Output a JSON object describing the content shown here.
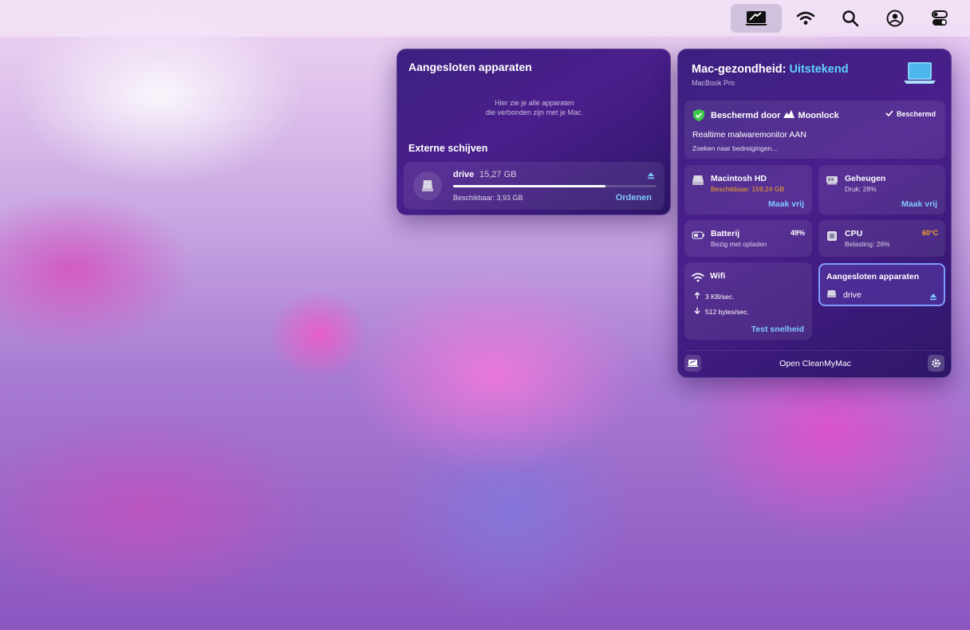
{
  "colors": {
    "accent_blue": "#7fc7ff",
    "status_good": "#5fd4ff",
    "warning_orange": "#f5a623",
    "shield_green": "#3bc94a"
  },
  "menubar": {
    "icons": [
      "cleanmymac-menu-icon",
      "wifi-icon",
      "search-icon",
      "user-icon",
      "control-center-icon"
    ]
  },
  "devices_panel": {
    "title": "Aangesloten apparaten",
    "hint_line1": "Hier zie je alle apparaten",
    "hint_line2": "die verbonden zijn met je Mac.",
    "section_title": "Externe schijven",
    "drive": {
      "name": "drive",
      "size": "15,27 GB",
      "used_fraction": 0.75,
      "available": "Beschikbaar: 3,93 GB",
      "action": "Ordenen"
    }
  },
  "health_panel": {
    "title_prefix": "Mac-gezondheid:",
    "status": "Uitstekend",
    "model": "MacBook Pro",
    "security": {
      "protected_by": "Beschermd door",
      "vendor": "Moonlock",
      "status": "Beschermd",
      "monitor": "Realtime malwaremonitor AAN",
      "scanning": "Zoeken naar bedreigingen..."
    },
    "disk": {
      "title": "Macintosh HD",
      "available": "Beschikbaar: 159,24 GB",
      "action": "Maak vrij"
    },
    "memory": {
      "title": "Geheugen",
      "pressure": "Druk: 28%",
      "action": "Maak vrij"
    },
    "battery": {
      "title": "Batterij",
      "status": "Bezig met opladen",
      "level": "49%"
    },
    "cpu": {
      "title": "CPU",
      "load": "Belasting: 26%",
      "temp": "60°C"
    },
    "wifi": {
      "title": "Wifi",
      "upload": "3 KB/sec.",
      "download": "512 bytes/sec.",
      "action": "Test snelheid"
    },
    "connected": {
      "title": "Aangesloten apparaten",
      "drive": "drive"
    },
    "open_button": "Open CleanMyMac"
  }
}
